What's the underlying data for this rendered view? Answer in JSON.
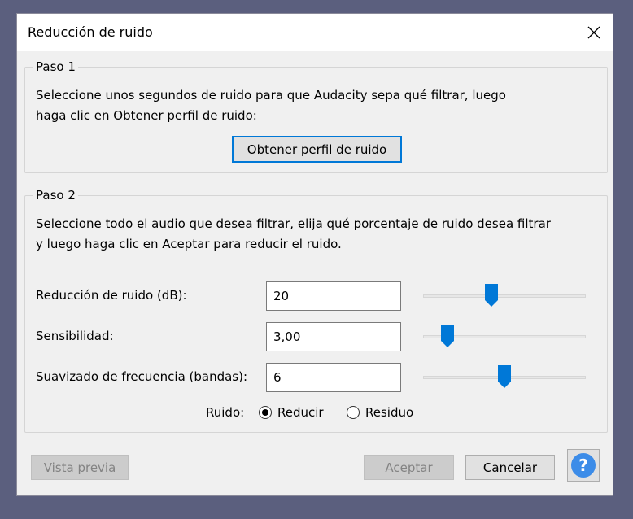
{
  "window": {
    "title": "Reducción de ruido"
  },
  "step1": {
    "legend": "Paso 1",
    "description_line1": "Seleccione unos segundos de ruido para que Audacity sepa qué filtrar, luego",
    "description_line2": "haga clic en Obtener perfil de ruido:",
    "get_profile_button": "Obtener perfil de ruido"
  },
  "step2": {
    "legend": "Paso 2",
    "description_line1": "Seleccione todo el audio que desea filtrar, elija qué porcentaje de ruido desea filtrar",
    "description_line2": "y luego haga clic en Aceptar para reducir el ruido.",
    "fields": [
      {
        "label": "Reducción de ruido (dB):",
        "value": "20",
        "slider_fraction": 0.42
      },
      {
        "label": "Sensibilidad:",
        "value": "3,00",
        "slider_fraction": 0.15
      },
      {
        "label": "Suavizado de frecuencia (bandas):",
        "value": "6",
        "slider_fraction": 0.5
      }
    ],
    "noise_label": "Ruido:",
    "radio_options": [
      {
        "label": "Reducir",
        "selected": true
      },
      {
        "label": "Residuo",
        "selected": false
      }
    ]
  },
  "buttons": {
    "preview": "Vista previa",
    "ok": "Aceptar",
    "cancel": "Cancelar"
  },
  "colors": {
    "accent": "#0078d7",
    "help": "#3c8ce8"
  },
  "icons": {
    "close": "close-icon",
    "help": "help-icon"
  }
}
